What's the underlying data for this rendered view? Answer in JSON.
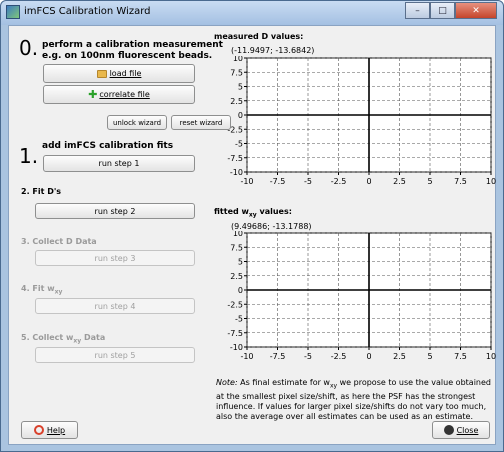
{
  "window": {
    "title": "imFCS Calibration Wizard",
    "buttons": {
      "minimize": "–",
      "maximize": "□",
      "close": "✕"
    }
  },
  "step0": {
    "number": "0.",
    "text_line1": "perform a calibration measurement",
    "text_line2": "e.g. on 100nm fluorescent beads.",
    "load_file_label": "load file",
    "correlate_file_label": "correlate file",
    "unlock_wizard_label": "unlock wizard",
    "reset_wizard_label": "reset wizard"
  },
  "step1": {
    "number": "1.",
    "text": "add imFCS calibration fits",
    "button": "run step 1"
  },
  "step2": {
    "heading": "2.  Fit D's",
    "button": "run step 2"
  },
  "step3": {
    "heading": "3.  Collect D Data",
    "button": "run step 3"
  },
  "step4": {
    "heading": "4.  Fit w",
    "heading_sub": "xy",
    "button": "run step 4"
  },
  "step5": {
    "heading": "5.  Collect w",
    "heading_sub": "xy",
    "heading_rest": " Data",
    "button": "run step 5"
  },
  "plots": [
    {
      "title": "measured D values:",
      "coord": "(-11.9497; -13.6842)",
      "x_ticks": [
        "-10",
        "-7.5",
        "-5",
        "-2.5",
        "0",
        "2.5",
        "5",
        "7.5",
        "10"
      ],
      "y_ticks": [
        "10",
        "7.5",
        "5",
        "2.5",
        "0",
        "-2.5",
        "-5",
        "-7.5",
        "-10"
      ]
    },
    {
      "title_pre": "fitted w",
      "title_sub": "xy",
      "title_post": " values:",
      "coord": "(9.49686; -13.1788)",
      "x_ticks": [
        "-10",
        "-7.5",
        "-5",
        "-2.5",
        "0",
        "2.5",
        "5",
        "7.5",
        "10"
      ],
      "y_ticks": [
        "10",
        "7.5",
        "5",
        "2.5",
        "0",
        "-2.5",
        "-5",
        "-7.5",
        "-10"
      ]
    }
  ],
  "note": {
    "prefix": "Note:",
    "text_a": " As final estimate for w",
    "text_sub": "xy",
    "text_b": " we propose to use the value obtained at the smallest pixel size/shift, as here the PSF has the strongest influence. If values for larger pixel size/shifts do not vary too much, also the average over all estimates can be used as an estimate."
  },
  "footer": {
    "help_label": "Help",
    "close_label": "Close"
  },
  "chart_data": [
    {
      "type": "scatter",
      "title": "measured D values:",
      "xlim": [
        -10,
        10
      ],
      "ylim": [
        -10,
        10
      ],
      "grid": true,
      "x_ticks": [
        -10,
        -7.5,
        -5,
        -2.5,
        0,
        2.5,
        5,
        7.5,
        10
      ],
      "y_ticks": [
        -10,
        -7.5,
        -5,
        -2.5,
        0,
        2.5,
        5,
        7.5,
        10
      ],
      "series": []
    },
    {
      "type": "scatter",
      "title": "fitted wxy values:",
      "xlim": [
        -10,
        10
      ],
      "ylim": [
        -10,
        10
      ],
      "grid": true,
      "x_ticks": [
        -10,
        -7.5,
        -5,
        -2.5,
        0,
        2.5,
        5,
        7.5,
        10
      ],
      "y_ticks": [
        -10,
        -7.5,
        -5,
        -2.5,
        0,
        2.5,
        5,
        7.5,
        10
      ],
      "series": []
    }
  ]
}
